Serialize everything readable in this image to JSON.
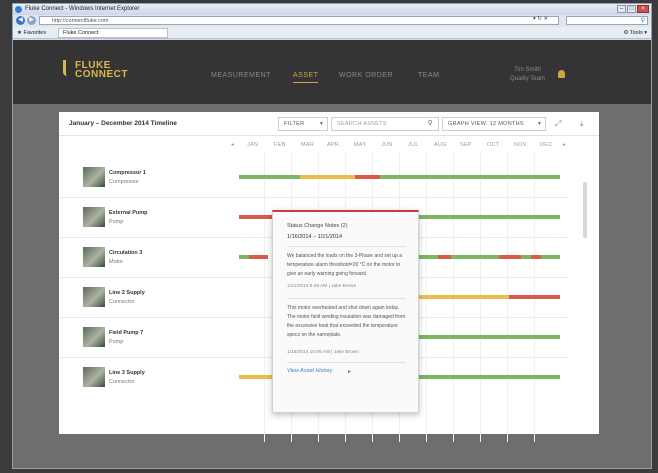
{
  "browser": {
    "title": "Fluke Connect - Windows Internet Explorer",
    "address": "http://connectfluke.com",
    "tab_label": "Fluke Connect",
    "favorites_label": "Favorites",
    "tools_label": "Tools"
  },
  "app": {
    "logo_line1": "FLUKE",
    "logo_line2": "CONNECT",
    "nav": [
      "MEASUREMENT",
      "ASSET",
      "WORK ORDER",
      "TEAM"
    ],
    "active_nav": "ASSET",
    "user_line1": "Tim Smith",
    "user_line2": "Quality Team"
  },
  "toolbar": {
    "title": "January – December 2014 Timeline",
    "filter_label": "FILTER",
    "search_placeholder": "SEARCH ASSETS",
    "graph_view_label": "GRAPH VIEW: 12 MONTHS"
  },
  "months": [
    "JAN",
    "FEB",
    "MAR",
    "APR",
    "MAY",
    "JUN",
    "JUL",
    "AUG",
    "SEP",
    "OCT",
    "NOV",
    "DEC"
  ],
  "colors": {
    "good": "#7bb661",
    "warn": "#e8be4e",
    "bad": "#d85a4a",
    "alert_accent": "#c73b3b",
    "brand": "#cfa647"
  },
  "assets": [
    {
      "name": "Compressor 1",
      "type": "Compressor",
      "segments": [
        [
          "good",
          0.19
        ],
        [
          "warn",
          0.17
        ],
        [
          "bad",
          0.08
        ],
        [
          "good",
          0.56
        ]
      ]
    },
    {
      "name": "External Pump",
      "type": "Pump",
      "segments": [
        [
          "bad",
          0.12
        ],
        [
          "none",
          0.44
        ],
        [
          "good",
          0.44
        ]
      ]
    },
    {
      "name": "Circulation 3",
      "type": "Motor",
      "segments": [
        [
          "good",
          0.03
        ],
        [
          "bad",
          0.06
        ],
        [
          "none",
          0.47
        ],
        [
          "good",
          0.06
        ],
        [
          "bad",
          0.04
        ],
        [
          "good",
          0.15
        ],
        [
          "bad",
          0.07
        ],
        [
          "good",
          0.03
        ],
        [
          "bad",
          0.03
        ],
        [
          "good",
          0.06
        ]
      ]
    },
    {
      "name": "Line 2 Supply",
      "type": "Connector",
      "segments": [
        [
          "none",
          0.56
        ],
        [
          "warn",
          0.28
        ],
        [
          "bad",
          0.16
        ]
      ]
    },
    {
      "name": "Field Pump 7",
      "type": "Pump",
      "segments": [
        [
          "none",
          0.56
        ],
        [
          "good",
          0.44
        ]
      ]
    },
    {
      "name": "Line 3 Supply",
      "type": "Connector",
      "segments": [
        [
          "warn",
          0.13
        ],
        [
          "none",
          0.43
        ],
        [
          "good",
          0.44
        ]
      ]
    }
  ],
  "popup": {
    "title": "Status Change Notes (2)",
    "range": "1/16/2014 – 1/21/2014",
    "note1": "We balanced the loads on the 3-Phase and set up a temperature alarm threshold=20 °C on the motor to give an early warning going forward.",
    "meta1": "1/21/2014   6:48 AM   |   Jake Brown",
    "note2": "This motor overheated and shut down again today. The motor field winding insulation was damaged from the excessive heat that exceeded the temperature specs on the nameplate.",
    "meta2": "1/16/2014   10:08 AM   |   Jake Brown",
    "link": "View Asset History"
  }
}
